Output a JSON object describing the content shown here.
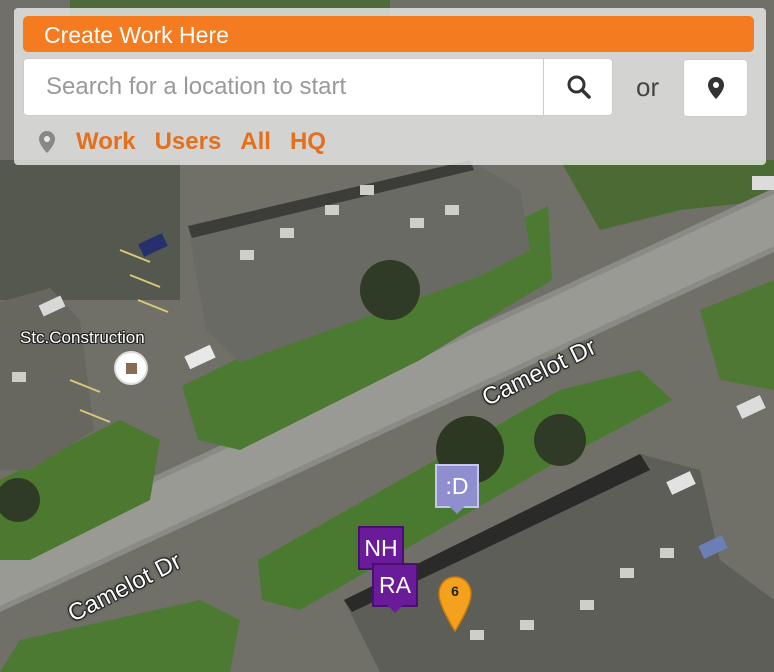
{
  "panel": {
    "create_work_label": "Create Work Here",
    "search_placeholder": "Search for a location to start",
    "search_value": "",
    "or_label": "or",
    "filters": [
      "Work",
      "Users",
      "All",
      "HQ"
    ]
  },
  "map": {
    "streets": [
      "Camelot Dr",
      "Camelot Dr"
    ],
    "poi": {
      "label": "Stc.Construction"
    },
    "users": [
      ":D",
      "NH",
      "RA"
    ],
    "work_cluster_count": "6"
  },
  "colors": {
    "accent_orange": "#f47b20",
    "filter_orange": "#e4701e",
    "user_purple": "#6a1b9a",
    "user_lavender": "#8f8fcf",
    "pin_orange": "#f4a21e"
  }
}
